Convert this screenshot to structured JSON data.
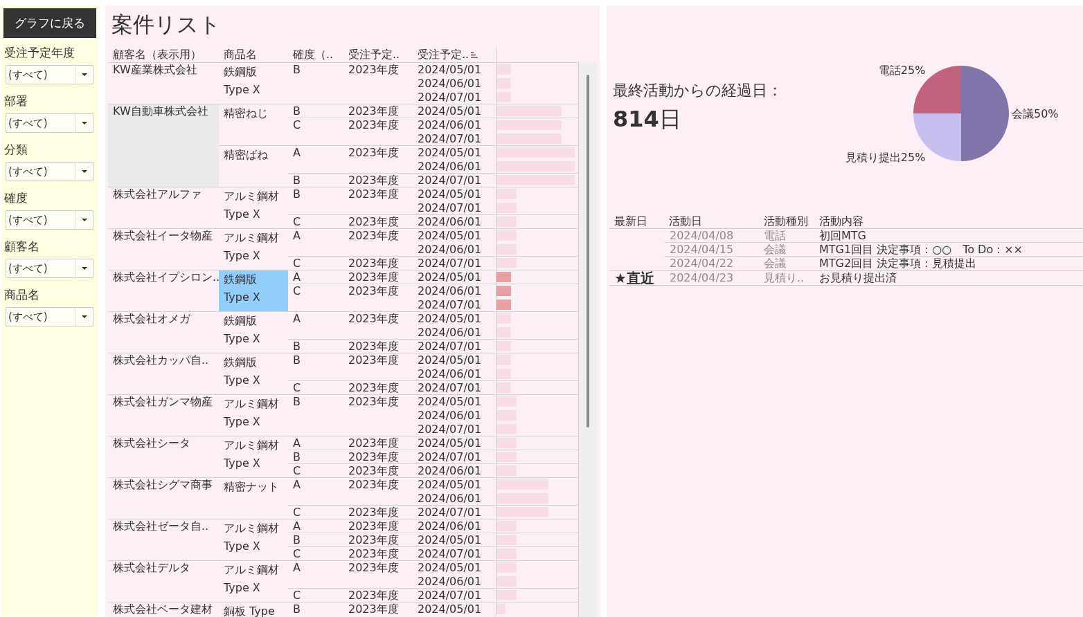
{
  "sidebar": {
    "back_button": "グラフに戻る",
    "filters": [
      {
        "label": "受注予定年度",
        "value": "(すべて)"
      },
      {
        "label": "部署",
        "value": "(すべて)"
      },
      {
        "label": "分類",
        "value": "(すべて)"
      },
      {
        "label": "確度",
        "value": "(すべて)"
      },
      {
        "label": "顧客名",
        "value": "(すべて)"
      },
      {
        "label": "商品名",
        "value": "(すべて)"
      }
    ]
  },
  "deal_list": {
    "title": "案件リスト",
    "columns": [
      {
        "label": "顧客名（表示用）",
        "sorted": false
      },
      {
        "label": "商品名",
        "sorted": false
      },
      {
        "label": "確度（..",
        "sorted": false
      },
      {
        "label": "受注予定..",
        "sorted": false
      },
      {
        "label": "受注予定..",
        "sorted": true
      }
    ],
    "customers": [
      {
        "name": "KW産業株式会社",
        "hovered": false,
        "products": [
          {
            "name": "鉄鋼版 Type X",
            "selected": false,
            "certainties": [
              {
                "grade": "B",
                "fiscal_year": "2023年度",
                "orders": [
                  {
                    "date": "2024/05/01",
                    "level": 0.18
                  },
                  {
                    "date": "2024/06/01",
                    "level": 0.18
                  },
                  {
                    "date": "2024/07/01",
                    "level": 0.18
                  }
                ]
              }
            ]
          }
        ]
      },
      {
        "name": "KW自動車株式会社",
        "hovered": true,
        "products": [
          {
            "name": "精密ねじ",
            "selected": false,
            "certainties": [
              {
                "grade": "B",
                "fiscal_year": "2023年度",
                "orders": [
                  {
                    "date": "2024/05/01",
                    "level": 0.79
                  }
                ]
              },
              {
                "grade": "C",
                "fiscal_year": "2023年度",
                "orders": [
                  {
                    "date": "2024/06/01",
                    "level": 0.79
                  },
                  {
                    "date": "2024/07/01",
                    "level": 0.79
                  }
                ]
              }
            ]
          },
          {
            "name": "精密ばね",
            "selected": false,
            "certainties": [
              {
                "grade": "A",
                "fiscal_year": "2023年度",
                "orders": [
                  {
                    "date": "2024/05/01",
                    "level": 0.95
                  },
                  {
                    "date": "2024/06/01",
                    "level": 0.95
                  }
                ]
              },
              {
                "grade": "B",
                "fiscal_year": "2023年度",
                "orders": [
                  {
                    "date": "2024/07/01",
                    "level": 0.95
                  }
                ]
              }
            ]
          }
        ]
      },
      {
        "name": "株式会社アルファ",
        "hovered": false,
        "products": [
          {
            "name": "アルミ鋼材 Type X",
            "selected": false,
            "certainties": [
              {
                "grade": "B",
                "fiscal_year": "2023年度",
                "orders": [
                  {
                    "date": "2024/05/01",
                    "level": 0.24
                  },
                  {
                    "date": "2024/07/01",
                    "level": 0.24
                  }
                ]
              },
              {
                "grade": "C",
                "fiscal_year": "2023年度",
                "orders": [
                  {
                    "date": "2024/06/01",
                    "level": 0.24
                  }
                ]
              }
            ]
          }
        ]
      },
      {
        "name": "株式会社イータ物産",
        "hovered": false,
        "products": [
          {
            "name": "アルミ鋼材 Type X",
            "selected": false,
            "certainties": [
              {
                "grade": "A",
                "fiscal_year": "2023年度",
                "orders": [
                  {
                    "date": "2024/05/01",
                    "level": 0.24
                  },
                  {
                    "date": "2024/06/01",
                    "level": 0.24
                  }
                ]
              },
              {
                "grade": "C",
                "fiscal_year": "2023年度",
                "orders": [
                  {
                    "date": "2024/07/01",
                    "level": 0.24
                  }
                ]
              }
            ]
          }
        ]
      },
      {
        "name": "株式会社イプシロン..",
        "hovered": false,
        "products": [
          {
            "name": "鉄鋼版 Type X",
            "selected": true,
            "certainties": [
              {
                "grade": "A",
                "fiscal_year": "2023年度",
                "orders": [
                  {
                    "date": "2024/05/01",
                    "level": 0.18
                  }
                ]
              },
              {
                "grade": "C",
                "fiscal_year": "2023年度",
                "orders": [
                  {
                    "date": "2024/06/01",
                    "level": 0.18
                  },
                  {
                    "date": "2024/07/01",
                    "level": 0.18
                  }
                ]
              }
            ]
          }
        ]
      },
      {
        "name": "株式会社オメガ",
        "hovered": false,
        "products": [
          {
            "name": "鉄鋼版 Type X",
            "selected": false,
            "certainties": [
              {
                "grade": "A",
                "fiscal_year": "2023年度",
                "orders": [
                  {
                    "date": "2024/05/01",
                    "level": 0.18
                  },
                  {
                    "date": "2024/06/01",
                    "level": 0.18
                  }
                ]
              },
              {
                "grade": "B",
                "fiscal_year": "2023年度",
                "orders": [
                  {
                    "date": "2024/07/01",
                    "level": 0.18
                  }
                ]
              }
            ]
          }
        ]
      },
      {
        "name": "株式会社カッパ自..",
        "hovered": false,
        "products": [
          {
            "name": "鉄鋼版 Type X",
            "selected": false,
            "certainties": [
              {
                "grade": "B",
                "fiscal_year": "2023年度",
                "orders": [
                  {
                    "date": "2024/05/01",
                    "level": 0.18
                  },
                  {
                    "date": "2024/06/01",
                    "level": 0.18
                  }
                ]
              },
              {
                "grade": "C",
                "fiscal_year": "2023年度",
                "orders": [
                  {
                    "date": "2024/07/01",
                    "level": 0.18
                  }
                ]
              }
            ]
          }
        ]
      },
      {
        "name": "株式会社ガンマ物産",
        "hovered": false,
        "products": [
          {
            "name": "アルミ鋼材 Type X",
            "selected": false,
            "certainties": [
              {
                "grade": "B",
                "fiscal_year": "2023年度",
                "orders": [
                  {
                    "date": "2024/05/01",
                    "level": 0.24
                  },
                  {
                    "date": "2024/06/01",
                    "level": 0.24
                  },
                  {
                    "date": "2024/07/01",
                    "level": 0.24
                  }
                ]
              }
            ]
          }
        ]
      },
      {
        "name": "株式会社シータ",
        "hovered": false,
        "products": [
          {
            "name": "アルミ鋼材 Type X",
            "selected": false,
            "certainties": [
              {
                "grade": "A",
                "fiscal_year": "2023年度",
                "orders": [
                  {
                    "date": "2024/05/01",
                    "level": 0.24
                  }
                ]
              },
              {
                "grade": "B",
                "fiscal_year": "2023年度",
                "orders": [
                  {
                    "date": "2024/07/01",
                    "level": 0.24
                  }
                ]
              },
              {
                "grade": "C",
                "fiscal_year": "2023年度",
                "orders": [
                  {
                    "date": "2024/06/01",
                    "level": 0.24
                  }
                ]
              }
            ]
          }
        ]
      },
      {
        "name": "株式会社シグマ商事",
        "hovered": false,
        "products": [
          {
            "name": "精密ナット",
            "selected": false,
            "certainties": [
              {
                "grade": "A",
                "fiscal_year": "2023年度",
                "orders": [
                  {
                    "date": "2024/05/01",
                    "level": 0.63
                  },
                  {
                    "date": "2024/06/01",
                    "level": 0.63
                  }
                ]
              },
              {
                "grade": "C",
                "fiscal_year": "2023年度",
                "orders": [
                  {
                    "date": "2024/07/01",
                    "level": 0.63
                  }
                ]
              }
            ]
          }
        ]
      },
      {
        "name": "株式会社ゼータ自..",
        "hovered": false,
        "products": [
          {
            "name": "アルミ鋼材 Type X",
            "selected": false,
            "certainties": [
              {
                "grade": "A",
                "fiscal_year": "2023年度",
                "orders": [
                  {
                    "date": "2024/06/01",
                    "level": 0.24
                  }
                ]
              },
              {
                "grade": "B",
                "fiscal_year": "2023年度",
                "orders": [
                  {
                    "date": "2024/05/01",
                    "level": 0.24
                  }
                ]
              },
              {
                "grade": "C",
                "fiscal_year": "2023年度",
                "orders": [
                  {
                    "date": "2024/07/01",
                    "level": 0.24
                  }
                ]
              }
            ]
          }
        ]
      },
      {
        "name": "株式会社デルタ",
        "hovered": false,
        "products": [
          {
            "name": "アルミ鋼材 Type X",
            "selected": false,
            "certainties": [
              {
                "grade": "A",
                "fiscal_year": "2023年度",
                "orders": [
                  {
                    "date": "2024/05/01",
                    "level": 0.24
                  },
                  {
                    "date": "2024/06/01",
                    "level": 0.24
                  }
                ]
              },
              {
                "grade": "C",
                "fiscal_year": "2023年度",
                "orders": [
                  {
                    "date": "2024/07/01",
                    "level": 0.24
                  }
                ]
              }
            ]
          }
        ]
      },
      {
        "name": "株式会社ベータ建材",
        "hovered": false,
        "products": [
          {
            "name": "銅板 Type",
            "selected": false,
            "certainties": [
              {
                "grade": "B",
                "fiscal_year": "2023年度",
                "orders": [
                  {
                    "date": "2024/05/01",
                    "level": 0.11
                  }
                ]
              }
            ]
          }
        ]
      }
    ]
  },
  "activity": {
    "elapsed_label": "最終活動からの経過日：",
    "elapsed_value": "**814**日",
    "chart_data": {
      "type": "pie",
      "categories": [
        "会議",
        "見積り提出",
        "電話"
      ],
      "values": [
        50,
        25,
        25
      ],
      "colors": [
        "#8074a8",
        "#c7c0ef",
        "#c1627f"
      ],
      "value_labels": [
        "50%",
        "25%",
        "25%"
      ]
    },
    "table": {
      "columns": [
        "最新日",
        "活動日",
        "活動種別",
        "活動内容"
      ],
      "groups": [
        {
          "rows": [
            {
              "date": "2024/04/08",
              "type": "電話",
              "content": "初回MTG"
            },
            {
              "date": "2024/04/15",
              "type": "会議",
              "content": "MTG1回目 決定事項：○○　To Do：××"
            },
            {
              "date": "2024/04/22",
              "type": "会議",
              "content": "MTG2回目 決定事項：見積提出"
            }
          ]
        },
        {
          "label": "★直近",
          "rows": [
            {
              "date": "2024/04/23",
              "type": "見積り..",
              "content": "お見積り提出済"
            }
          ]
        }
      ]
    }
  }
}
